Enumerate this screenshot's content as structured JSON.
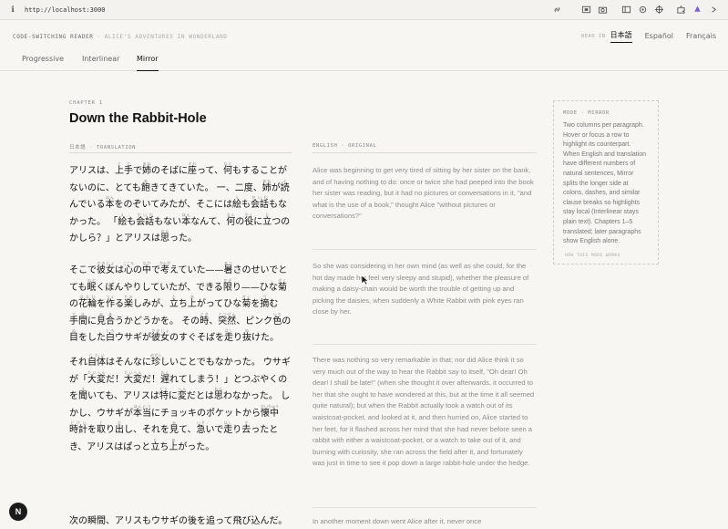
{
  "browser": {
    "url": "http://localhost:3000"
  },
  "header": {
    "brand": "CODE-SWITCHING READER",
    "separator": "·",
    "book": "ALICE'S ADVENTURES IN WONDERLAND",
    "read_in": "READ IN",
    "languages": [
      "日本語",
      "Español",
      "Français"
    ]
  },
  "tabs": [
    "Progressive",
    "Interlinear",
    "Mirror"
  ],
  "chapter": {
    "eyebrow": "CHAPTER 1",
    "title": "Down the Rabbit-Hole"
  },
  "columns": {
    "left": "日本語 · TRANSLATION",
    "right": "ENGLISH · ORIGINAL"
  },
  "paragraphs": [
    {
      "en": "Alice was beginning to get very tired of sitting by her sister on the bank, and of having nothing to do: once or twice she had peeped into the book her sister was reading, but it had no pictures or conversations in it, \"and what is the use of a book,\" thought Alice \"without pictures or conversations?\""
    },
    {
      "en": "So she was considering in her own mind (as well as she could, for the hot day made her feel very sleepy and stupid), whether the pleasure of making a daisy-chain would be worth the trouble of getting up and picking the daisies, when suddenly a White Rabbit with pink eyes ran close by her."
    },
    {
      "en": "There was nothing so very remarkable in that; nor did Alice think it so very much out of the way to hear the Rabbit say to itself, \"Oh dear! Oh dear! I shall be late!\" (when she thought it over afterwards, it occurred to her that she ought to have wondered at this, but at the time it all seemed quite natural); but when the Rabbit actually took a watch out of its waistcoat-pocket, and looked at it, and then hurried on, Alice started to her feet, for it flashed across her mind that she had never before seen a rabbit with either a waistcoat-pocket, or a watch to take out of it, and burning with curiosity, she ran across the field after it, and fortunately was just in time to see it pop down a large rabbit-hole under the hedge."
    },
    {
      "jp": "次の瞬間、アリスもウサギの後を追って飛び込んだ。",
      "en": "In another moment down went Alice after it, never once"
    }
  ],
  "note": {
    "eyebrow": "MODE · MIRROR",
    "body": "Two columns per paragraph. Hover or focus a row to highlight its counterpart. When English and translation have different numbers of natural sentences, Mirror splits the longer side at colons, dashes, and similar clause breaks so highlights stay local (Interlinear stays plain text). Chapters 1–5 translated; later paragraphs show English alone.",
    "link": "HOW THIS MODE WORKS"
  },
  "float_button": "N"
}
